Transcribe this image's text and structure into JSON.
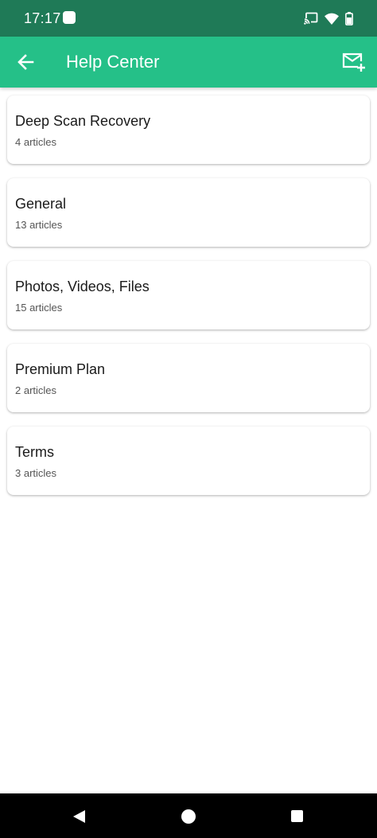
{
  "status_bar": {
    "time": "17:17",
    "icons": [
      "notification-icon",
      "cast-icon",
      "wifi-icon",
      "battery-icon"
    ]
  },
  "app_bar": {
    "title": "Help Center",
    "back_icon": "arrow-back-icon",
    "action_icon": "mail-add-icon",
    "background_color": "#25c088",
    "status_color": "#1f7a57"
  },
  "categories": [
    {
      "name": "Deep Scan Recovery",
      "count": "4 articles"
    },
    {
      "name": "General",
      "count": "13 articles"
    },
    {
      "name": "Photos, Videos, Files",
      "count": "15 articles"
    },
    {
      "name": "Premium Plan",
      "count": "2 articles"
    },
    {
      "name": "Terms",
      "count": "3 articles"
    }
  ],
  "nav_bar": {
    "icons": [
      "nav-back-icon",
      "nav-home-icon",
      "nav-recents-icon"
    ]
  }
}
